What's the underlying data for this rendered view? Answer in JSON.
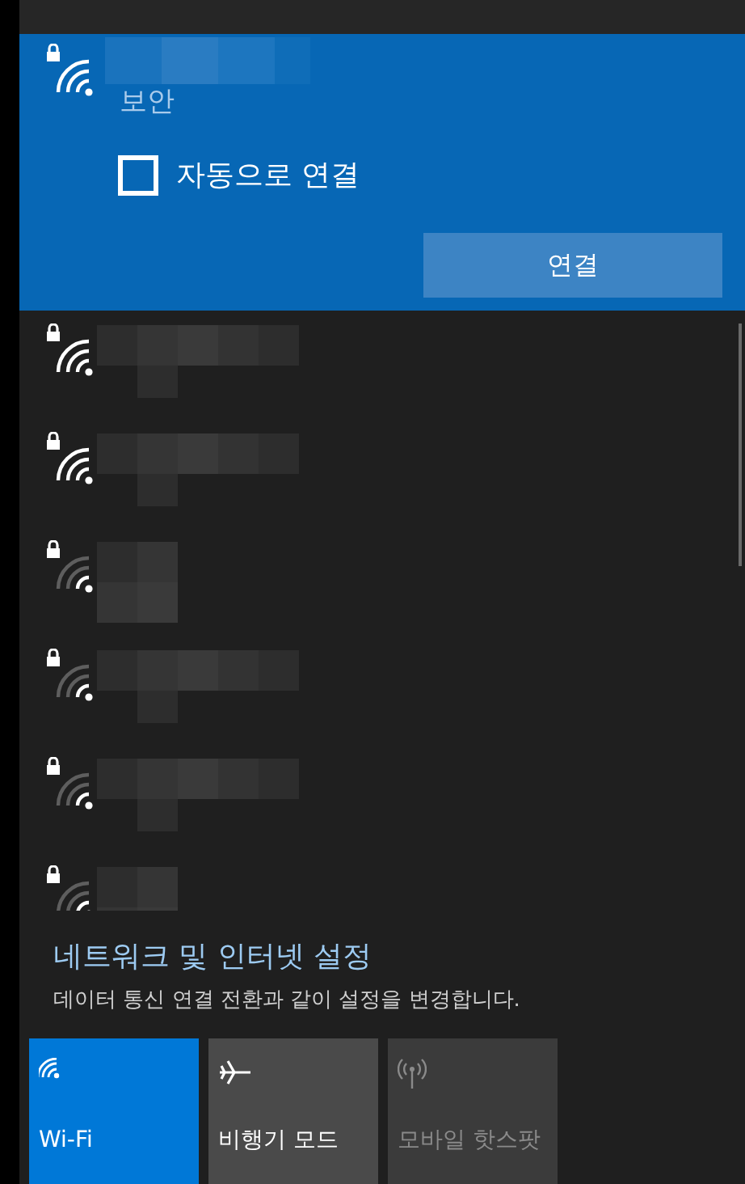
{
  "selected_network": {
    "status": "보안",
    "auto_connect": {
      "label": "자동으로 연결",
      "checked": false
    },
    "button": "연결",
    "strong_signal": true
  },
  "networks": [
    {
      "strong_signal": true,
      "long_name": true
    },
    {
      "strong_signal": true,
      "long_name": true
    },
    {
      "strong_signal": false,
      "long_name": false
    },
    {
      "strong_signal": false,
      "long_name": true
    },
    {
      "strong_signal": false,
      "long_name": true
    },
    {
      "strong_signal": false,
      "long_name": false
    }
  ],
  "settings": {
    "link": "네트워크 및 인터넷 설정",
    "description": "데이터 통신 연결 전환과 같이 설정을 변경합니다."
  },
  "tiles": [
    {
      "kind": "wifi",
      "label": "Wi-Fi",
      "on": true,
      "disabled": false
    },
    {
      "kind": "airplane",
      "label": "비행기 모드",
      "on": false,
      "disabled": false
    },
    {
      "kind": "hotspot",
      "label": "모바일 핫스팟",
      "on": false,
      "disabled": true
    }
  ]
}
